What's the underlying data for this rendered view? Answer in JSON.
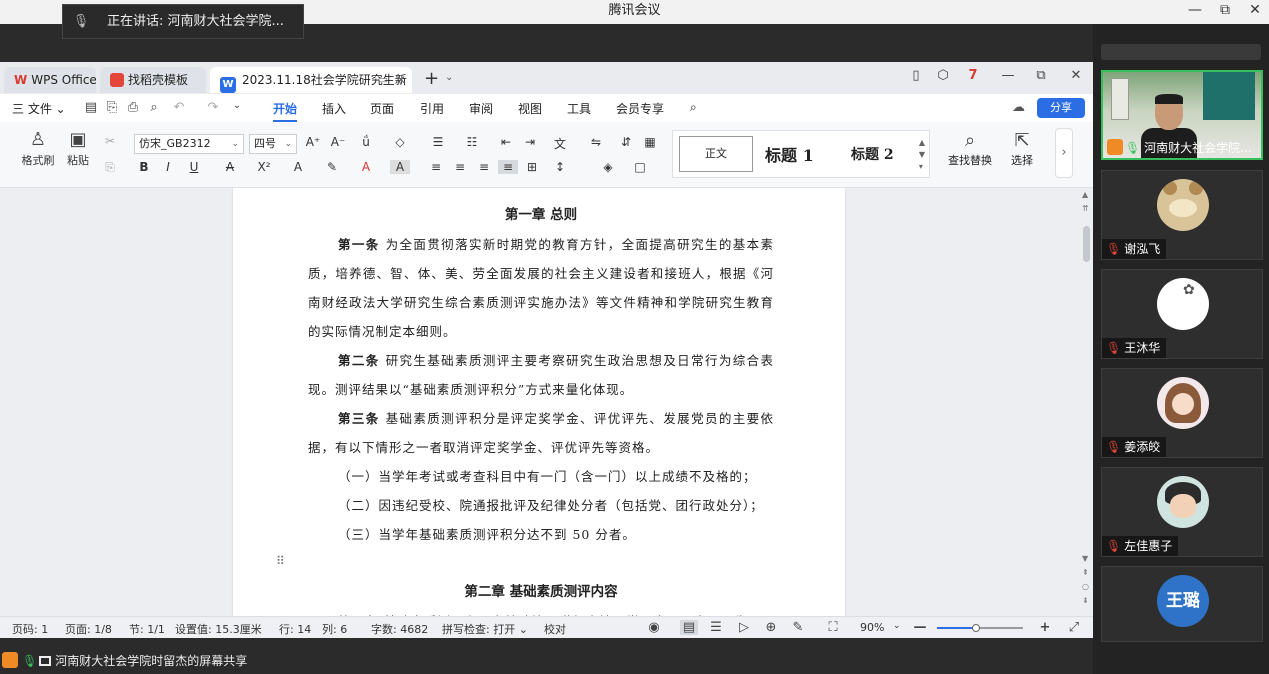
{
  "meeting": {
    "app_title": "腾讯会议",
    "speaking_label": "正在讲话:  河南财大社会学院...",
    "screen_share_label": "河南财大社会学院时留杰的屏幕共享",
    "controls": {
      "minimize": "—",
      "restore": "⧉",
      "close": "✕"
    }
  },
  "wps": {
    "tabs": {
      "wps_office": "WPS Office",
      "templates": "找稻壳模板",
      "document": "2023.11.18社会学院研究生新",
      "add": "+"
    },
    "menu": {
      "file": "三 文件 ⌄",
      "items": [
        "开始",
        "插入",
        "页面",
        "引用",
        "审阅",
        "视图",
        "工具",
        "会员专享"
      ],
      "active_item": "开始",
      "share": "分享"
    },
    "ribbon": {
      "format_painter": "格式刷",
      "paste": "粘贴",
      "font_name": "仿宋_GB2312",
      "font_size": "四号",
      "style_normal": "正文",
      "style_h1": "标题 1",
      "style_h2": "标题 2",
      "find_replace": "查找替换",
      "select": "选择"
    },
    "document": {
      "chapter1": "第一章  总则",
      "article1_lead": "第一条",
      "article1_text": "为全面贯彻落实新时期党的教育方针，全面提高研究生的基本素质，培养德、智、体、美、劳全面发展的社会主义建设者和接班人，根据《河南财经政法大学研究生综合素质测评实施办法》等文件精神和学院研究生教育的实际情况制定本细则。",
      "article2_lead": "第二条",
      "article2_text": "研究生基础素质测评主要考察研究生政治思想及日常行为综合表现。测评结果以“基础素质测评积分”方式来量化体现。",
      "article3_lead": "第三条",
      "article3_text": "基础素质测评积分是评定奖学金、评优评先、发展党员的主要依据，有以下情形之一者取消评定奖学金、评优评先等资格。",
      "items": [
        "（一）当学年考试或考查科目中有一门（含一门）以上成绩不及格的；",
        "（二）因违纪受校、院通报批评及纪律处分者（包括党、团行政处分）；",
        "（三）当学年基础素质测评积分达不到 50 分者。"
      ],
      "chapter2": "第二章  基础素质测评内容",
      "next_line_partial": "第四条  基础素质测评主要考核政治、遵纪守法、学习表现、文明卫生"
    },
    "status": {
      "page_no": "页码: 1",
      "pages": "页面: 1/8",
      "section": "节: 1/1",
      "setting": "设置值: 15.3厘米",
      "row": "行: 14",
      "col": "列: 6",
      "word_count": "字数: 4682",
      "spell_check": "拼写检查: 打开 ⌄",
      "proofread": "校对",
      "zoom": "90%",
      "zoom_fraction": 0.45
    }
  },
  "participants": [
    {
      "name": "河南财大社会学院...",
      "mic": "on",
      "avatar": "camera"
    },
    {
      "name": "谢泓飞",
      "mic": "muted",
      "avatar": "bear-avatar"
    },
    {
      "name": "王沐华",
      "mic": "muted",
      "avatar": "white-avatar"
    },
    {
      "name": "姜添皎",
      "mic": "muted",
      "avatar": "girl-avatar"
    },
    {
      "name": "左佳惠子",
      "mic": "muted",
      "avatar": "boy-avatar"
    },
    {
      "name": "王璐",
      "mic": "muted",
      "avatar": "text-avatar",
      "avatar_text": "王璐"
    }
  ],
  "colors": {
    "accent": "#2b6de5",
    "active_speaker_border": "#36c05b",
    "muted_mic": "#e5463a"
  }
}
